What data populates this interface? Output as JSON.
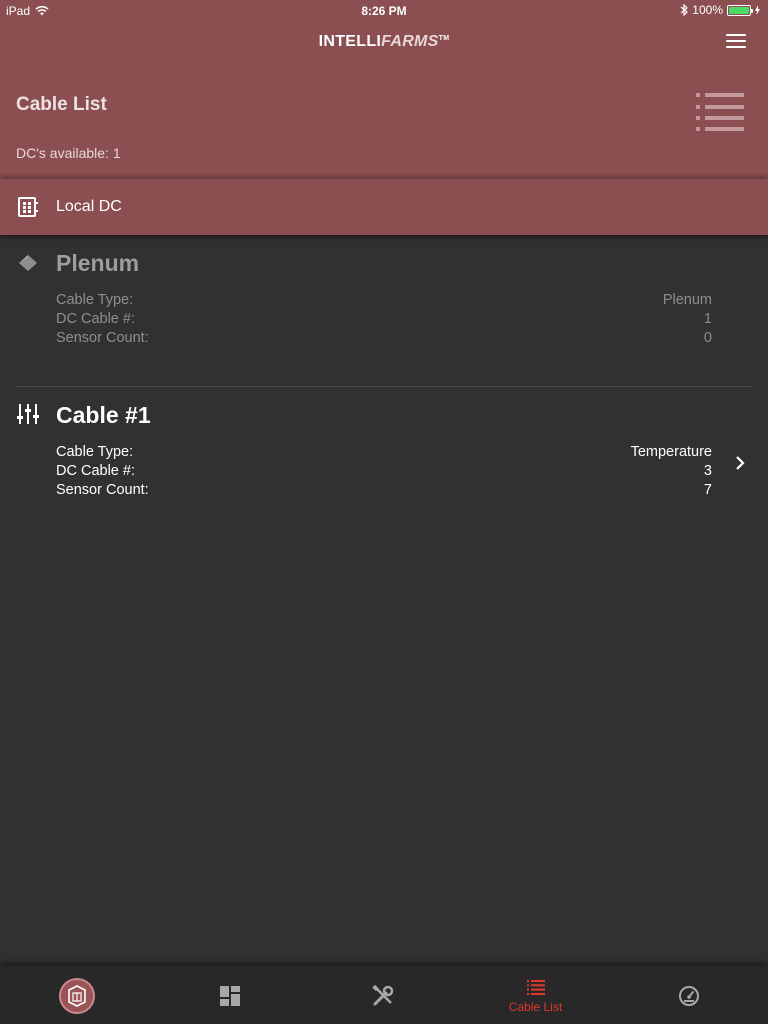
{
  "status_bar": {
    "device": "iPad",
    "time": "8:26 PM",
    "battery": "100%"
  },
  "brand": {
    "part1": "INTELLI",
    "part2": "FARMS",
    "tm": "TM"
  },
  "page": {
    "title": "Cable List",
    "dc_available": "DC's available: 1"
  },
  "local_dc": {
    "label": "Local DC"
  },
  "cables": [
    {
      "title": "Plenum",
      "rows": [
        {
          "label": "Cable Type:",
          "value": "Plenum"
        },
        {
          "label": "DC Cable #:",
          "value": "1"
        },
        {
          "label": "Sensor Count:",
          "value": "0"
        }
      ]
    },
    {
      "title": "Cable #1",
      "rows": [
        {
          "label": "Cable Type:",
          "value": "Temperature"
        },
        {
          "label": "DC Cable #:",
          "value": "3"
        },
        {
          "label": "Sensor Count:",
          "value": "7"
        }
      ]
    }
  ],
  "tabbar": {
    "tabs": [
      {
        "icon": "intellifarms-logo-icon",
        "label": ""
      },
      {
        "icon": "dashboard-icon",
        "label": ""
      },
      {
        "icon": "tools-icon",
        "label": ""
      },
      {
        "icon": "list-icon",
        "label": "Cable List"
      },
      {
        "icon": "gauge-icon",
        "label": ""
      }
    ],
    "active_color": "#e2382b"
  },
  "colors": {
    "header": "#8b4f51",
    "background": "#313131",
    "tabbar": "#282828"
  }
}
